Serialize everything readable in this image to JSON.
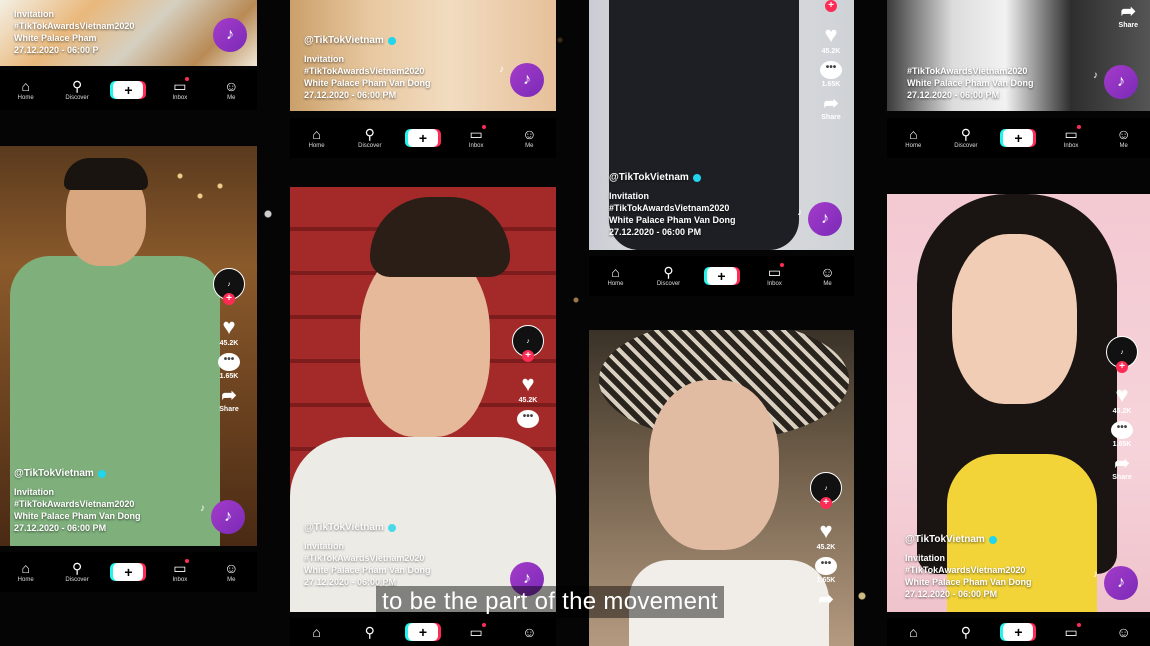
{
  "nav": {
    "home": "Home",
    "discover": "Discover",
    "inbox": "Inbox",
    "me": "Me",
    "add": "+"
  },
  "post": {
    "handle": "@TikTokVietnam",
    "line1": "Invitation",
    "line2": "#TikTokAwardsVietnam2020",
    "line3": "White Palace Pham Van Dong",
    "line4": "27.12.2020 - 06:00 PM"
  },
  "post_partial": {
    "line3": "White Palace Pham",
    "line4": "27.12.2020 - 06:00 P"
  },
  "actions": {
    "likes": "45.2K",
    "comments": "1.65K",
    "share": "Share"
  },
  "subtitle": "to be the part of the movement",
  "icons": [
    "home-icon",
    "search-icon",
    "add-icon",
    "inbox-icon",
    "profile-icon",
    "heart-icon",
    "comment-icon",
    "share-icon",
    "tiktok-logo-icon",
    "music-disc-icon",
    "music-note-icon",
    "verified-icon"
  ]
}
